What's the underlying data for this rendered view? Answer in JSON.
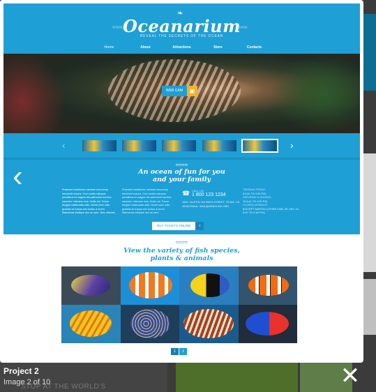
{
  "site": {
    "logo": "Oceanarium",
    "tagline": "REVEAL THE SECRETS OF THE OCEAN",
    "nav": [
      "Home",
      "About",
      "Attractions",
      "Store",
      "Contacts"
    ]
  },
  "hero": {
    "webcam_label": "WEB CAM"
  },
  "info": {
    "heading_line1": "An ocean of fun for you",
    "heading_line2": "and your family",
    "col1": "Praesent vestibulum aenean nonummy hendrerit mauris. Cum sociis natoque penatibus et magnis dis parturient montes nascetur ridiculus mus. Nulla dui. Fusce feugiat malesuada odio. Morbi nunc odio gravida at cursus nec luctus a lorem. Maecenas tristique orci ac sem. Duis ultricies",
    "col2": "Praesent vestibulum aenean nonummy hendrerit mauris. Cum sociis natoque penatibus et magnis dis parturient montes nascetur ridiculus mus. Nulla dui. Fusce feugiat malesuada odio. Morbi nunc odio gravida at cursus nec luctus a lorem. Maecenas tristique orci ac sem.",
    "call_label": "CALL US:",
    "phone": "1 800 123 1234",
    "address": "1654 / AUSTIN, MX 90876 STREET, TEXAS, CA 90548 EMAIL: MAIL@DEMOLINK.ORG",
    "hours_title1": "TUESDAY-FRIDAY:",
    "hours_value1": "8 A.M. TO 4:30 P.M.",
    "hours_title2": "SATURDAY & SUNDAY:",
    "hours_value2": "10 A.M. TO 4:30 P.M.",
    "hours_title3": "CLOSED MONDAYS",
    "hours_value3": "(EXCEPT MARTIN LUTHER KING JR. DAY, 10 A.M. TO 4:15 P.M.)",
    "buy_label": "BUY TICKETS ONLINE"
  },
  "variety": {
    "heading_line1": "View the variety of fish species,",
    "heading_line2": "plants & animals",
    "pager": [
      "1",
      "2"
    ]
  },
  "lightbox": {
    "title": "Project 2",
    "counter": "Image 2 of 10",
    "background_text": "STOP AT THE WORLD'S"
  },
  "colors": {
    "accent": "#1e9fd6",
    "white": "#ffffff",
    "ticket": "#f0b324"
  },
  "icons": [
    "fish-logo-icon",
    "webcam-icon",
    "phone-icon",
    "chevron-left-icon",
    "chevron-right-icon",
    "close-icon"
  ]
}
